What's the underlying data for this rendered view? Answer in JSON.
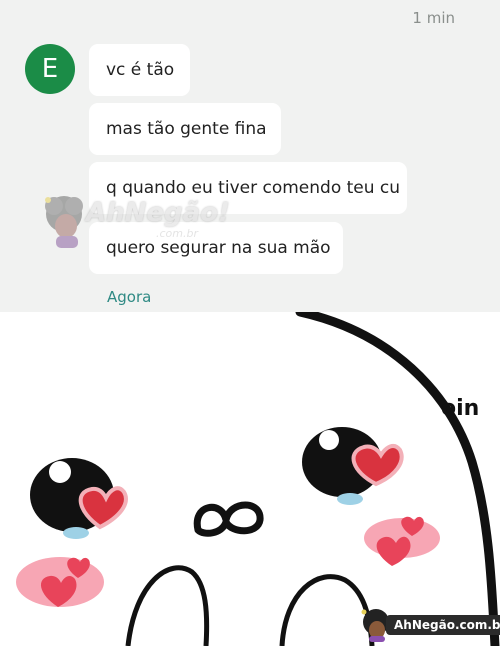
{
  "chat": {
    "timestamp_top": "1 min",
    "avatar_letter": "E",
    "messages": [
      "vc é tão",
      "mas tão gente fina",
      "q quando eu tiver comendo teu cu",
      "quero segurar na sua mão"
    ],
    "timestamp_bottom": "Agora"
  },
  "meme": {
    "caption": "oin"
  },
  "watermarks": {
    "center_text": "AhNegão!",
    "center_sub": ".com.br",
    "corner_text": "AhNegão.com.br"
  },
  "colors": {
    "chat_background": "#f1f2f1",
    "bubble": "#ffffff",
    "avatar": "#1b8c47",
    "timestamp_bottom": "#2f8a84",
    "heart": "#d9333f",
    "blush": "#f7a6b4"
  }
}
